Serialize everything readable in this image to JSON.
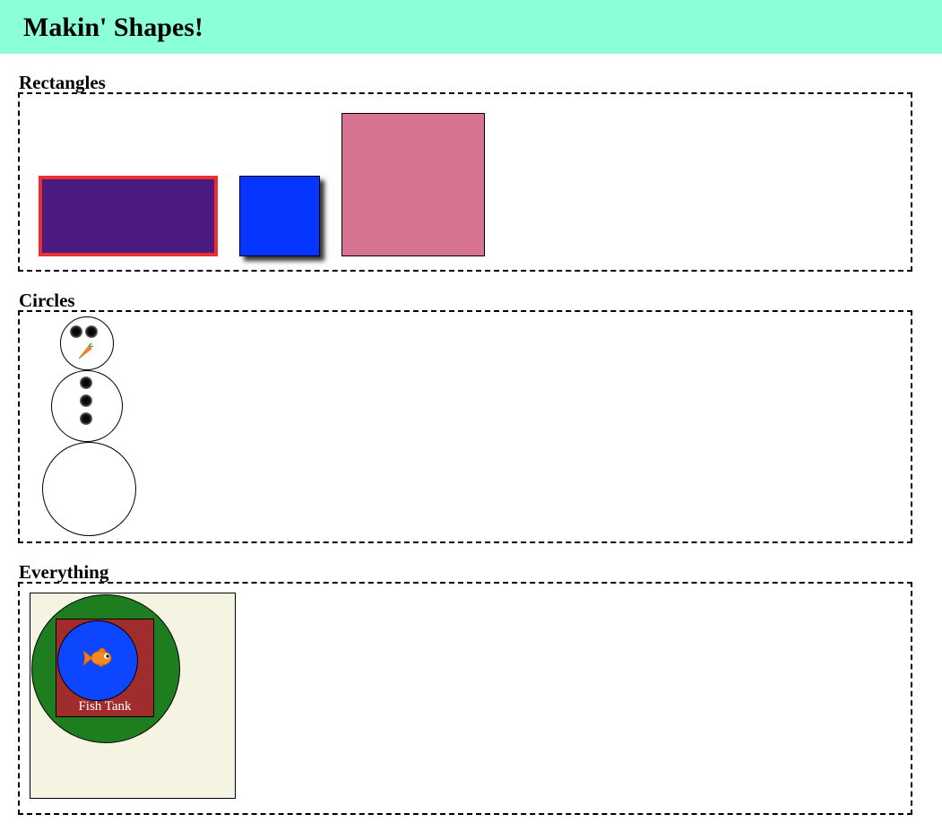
{
  "header": {
    "title": "Makin' Shapes!",
    "background": "#8bffd8"
  },
  "sections": {
    "rectangles": {
      "title": "Rectangles",
      "colors": {
        "purple": "#4a1a80",
        "red_border": "#ee2d2f",
        "blue": "#0535ff",
        "pink": "#d67390"
      }
    },
    "circles": {
      "title": "Circles",
      "snowman": {
        "eyes": 2,
        "nose_icon": "carrot-icon",
        "buttons": 3
      }
    },
    "everything": {
      "title": "Everything",
      "fish_tank_label": "Fish Tank",
      "fish_icon": "goldfish-icon",
      "colors": {
        "tan": "#f5f3e1",
        "green": "#1e7d1e",
        "red": "#a12c2c",
        "blue": "#0c46ff"
      }
    }
  }
}
